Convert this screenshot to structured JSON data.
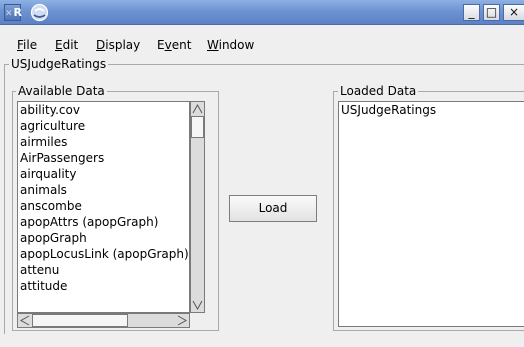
{
  "titlebar": {
    "app_icon_text": "R",
    "minimize_symbol": "_",
    "maximize_symbol": "□",
    "close_symbol": "×"
  },
  "menu": {
    "items": [
      {
        "label": "File",
        "mnemonic": "F",
        "rest": "ile"
      },
      {
        "label": "Edit",
        "mnemonic": "E",
        "rest": "dit"
      },
      {
        "label": "Display",
        "mnemonic": "D",
        "rest": "isplay"
      },
      {
        "label": "Event",
        "pre": "E",
        "mnemonic": "v",
        "rest": "ent"
      },
      {
        "label": "Window",
        "mnemonic": "W",
        "rest": "indow"
      }
    ]
  },
  "dataset_frame": {
    "title": "USJudgeRatings"
  },
  "available": {
    "title": "Available Data",
    "items": [
      "ability.cov",
      "agriculture",
      "airmiles",
      "AirPassengers",
      "airquality",
      "animals",
      "anscombe",
      "apopAttrs (apopGraph)",
      "apopGraph",
      "apopLocusLink (apopGraph)",
      "attenu",
      "attitude"
    ]
  },
  "loaded": {
    "title": "Loaded Data",
    "items": [
      "USJudgeRatings"
    ]
  },
  "load_button": {
    "label": "Load"
  }
}
